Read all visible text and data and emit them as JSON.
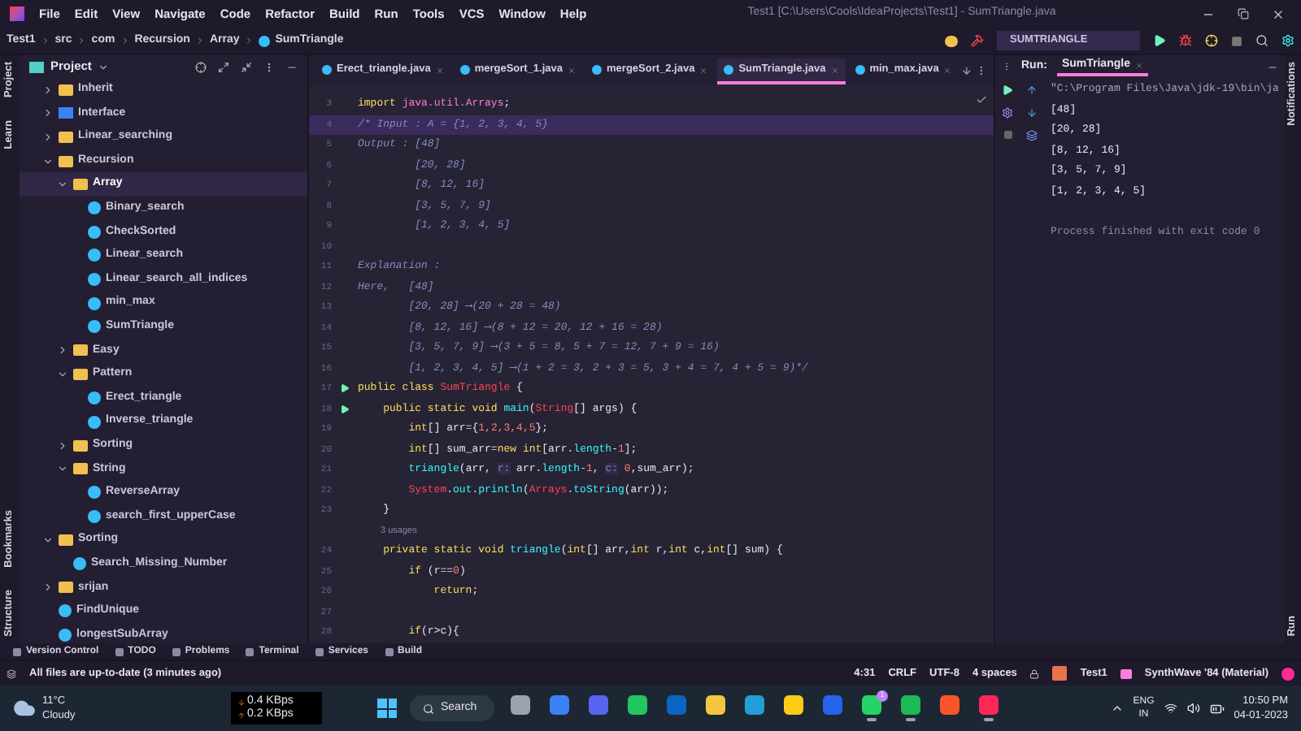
{
  "window": {
    "title": "Test1 [C:\\Users\\Cools\\IdeaProjects\\Test1] - SumTriangle.java"
  },
  "menu": [
    "File",
    "Edit",
    "View",
    "Navigate",
    "Code",
    "Refactor",
    "Build",
    "Run",
    "Tools",
    "VCS",
    "Window",
    "Help"
  ],
  "breadcrumb": [
    "Test1",
    "src",
    "com",
    "Recursion",
    "Array",
    "SumTriangle"
  ],
  "run_config": "SUMTRIANGLE",
  "left_strip": {
    "top": [
      "Project",
      "Learn"
    ],
    "bottom": [
      "Bookmarks",
      "Structure"
    ]
  },
  "project": {
    "title": "Project",
    "tree": [
      {
        "label": "Inherit",
        "kind": "folder",
        "expanded": false,
        "selected": false
      },
      {
        "label": "Interface",
        "kind": "package",
        "expanded": false,
        "selected": false
      },
      {
        "label": "Linear_searching",
        "kind": "folder",
        "expanded": false,
        "selected": false
      },
      {
        "label": "Recursion",
        "kind": "folder",
        "expanded": true,
        "selected": false,
        "children": [
          {
            "label": "Array",
            "kind": "folder",
            "expanded": true,
            "selected": true,
            "children": [
              {
                "label": "Binary_search",
                "kind": "class",
                "selected": false
              },
              {
                "label": "CheckSorted",
                "kind": "class",
                "selected": false
              },
              {
                "label": "Linear_search",
                "kind": "class",
                "selected": false
              },
              {
                "label": "Linear_search_all_indices",
                "kind": "class",
                "selected": false
              },
              {
                "label": "min_max",
                "kind": "class",
                "selected": false
              },
              {
                "label": "SumTriangle",
                "kind": "class",
                "selected": false
              }
            ]
          },
          {
            "label": "Easy",
            "kind": "folder",
            "expanded": false,
            "selected": false
          },
          {
            "label": "Pattern",
            "kind": "folder",
            "expanded": true,
            "selected": false,
            "children": [
              {
                "label": "Erect_triangle",
                "kind": "class",
                "selected": false
              },
              {
                "label": "Inverse_triangle",
                "kind": "class",
                "selected": false
              }
            ]
          },
          {
            "label": "Sorting",
            "kind": "folder",
            "expanded": false,
            "selected": false
          },
          {
            "label": "String",
            "kind": "folder",
            "expanded": true,
            "selected": false,
            "children": [
              {
                "label": "ReverseArray",
                "kind": "class",
                "selected": false
              },
              {
                "label": "search_first_upperCase",
                "kind": "class",
                "selected": false
              }
            ]
          }
        ]
      },
      {
        "label": "Sorting",
        "kind": "folder",
        "expanded": true,
        "selected": false,
        "children": [
          {
            "label": "Search_Missing_Number",
            "kind": "class",
            "selected": false
          }
        ]
      },
      {
        "label": "srijan",
        "kind": "folder",
        "expanded": false,
        "selected": false
      },
      {
        "label": "FindUnique",
        "kind": "class",
        "selected": false
      },
      {
        "label": "longestSubArray",
        "kind": "class",
        "selected": false
      }
    ]
  },
  "editor_tabs": [
    {
      "label": "Erect_triangle.java",
      "selected": false
    },
    {
      "label": "mergeSort_1.java",
      "selected": false
    },
    {
      "label": "mergeSort_2.java",
      "selected": false
    },
    {
      "label": "SumTriangle.java",
      "selected": true
    },
    {
      "label": "min_max.java",
      "selected": false
    }
  ],
  "code_lines": [
    {
      "kind": "code",
      "number": "3",
      "current": false,
      "run_marker": false,
      "tokens": [
        {
          "kind": "kw",
          "text": "import "
        },
        {
          "kind": "pkg",
          "text": "java.util.Arrays"
        },
        {
          "kind": "plain",
          "text": ";"
        }
      ]
    },
    {
      "kind": "code",
      "number": "4",
      "current": true,
      "run_marker": false,
      "tokens": [
        {
          "kind": "cmt",
          "text": "/* Input : A = {1, 2, 3, 4, 5}"
        }
      ]
    },
    {
      "kind": "code",
      "number": "5",
      "current": false,
      "run_marker": false,
      "tokens": [
        {
          "kind": "cmt",
          "text": "Output : [48]"
        }
      ]
    },
    {
      "kind": "code",
      "number": "6",
      "current": false,
      "run_marker": false,
      "tokens": [
        {
          "kind": "cmt",
          "text": "         [20, 28]"
        }
      ]
    },
    {
      "kind": "code",
      "number": "7",
      "current": false,
      "run_marker": false,
      "tokens": [
        {
          "kind": "cmt",
          "text": "         [8, 12, 16]"
        }
      ]
    },
    {
      "kind": "code",
      "number": "8",
      "current": false,
      "run_marker": false,
      "tokens": [
        {
          "kind": "cmt",
          "text": "         [3, 5, 7, 9]"
        }
      ]
    },
    {
      "kind": "code",
      "number": "9",
      "current": false,
      "run_marker": false,
      "tokens": [
        {
          "kind": "cmt",
          "text": "         [1, 2, 3, 4, 5]"
        }
      ]
    },
    {
      "kind": "code",
      "number": "10",
      "current": false,
      "run_marker": false
    },
    {
      "kind": "code",
      "number": "11",
      "current": false,
      "run_marker": false,
      "tokens": [
        {
          "kind": "cmt",
          "text": "Explanation :"
        }
      ]
    },
    {
      "kind": "code",
      "number": "12",
      "current": false,
      "run_marker": false,
      "tokens": [
        {
          "kind": "cmt",
          "text": "Here,   [48]"
        }
      ]
    },
    {
      "kind": "code",
      "number": "13",
      "current": false,
      "run_marker": false,
      "tokens": [
        {
          "kind": "cmt",
          "text": "        [20, 28] ⟶(20 + 28 = 48)"
        }
      ]
    },
    {
      "kind": "code",
      "number": "14",
      "current": false,
      "run_marker": false,
      "tokens": [
        {
          "kind": "cmt",
          "text": "        [8, 12, 16] ⟶(8 + 12 = 20, 12 + 16 = 28)"
        }
      ]
    },
    {
      "kind": "code",
      "number": "15",
      "current": false,
      "run_marker": false,
      "tokens": [
        {
          "kind": "cmt",
          "text": "        [3, 5, 7, 9] ⟶(3 + 5 = 8, 5 + 7 = 12, 7 + 9 = 16)"
        }
      ]
    },
    {
      "kind": "code",
      "number": "16",
      "current": false,
      "run_marker": false,
      "tokens": [
        {
          "kind": "cmt",
          "text": "        [1, 2, 3, 4, 5] ⟶(1 + 2 = 3, 2 + 3 = 5, 3 + 4 = 7, 4 + 5 = 9)*/"
        }
      ]
    },
    {
      "kind": "code",
      "number": "17",
      "current": false,
      "run_marker": true,
      "tokens": [
        {
          "kind": "kw",
          "text": "public class "
        },
        {
          "kind": "cls",
          "text": "SumTriangle"
        },
        {
          "kind": "plain",
          "text": " {"
        }
      ]
    },
    {
      "kind": "code",
      "number": "18",
      "current": false,
      "run_marker": true,
      "tokens": [
        {
          "kind": "kw",
          "text": "    public static void "
        },
        {
          "kind": "fn",
          "text": "main"
        },
        {
          "kind": "plain",
          "text": "("
        },
        {
          "kind": "cls",
          "text": "String"
        },
        {
          "kind": "plain",
          "text": "[] args) {"
        }
      ]
    },
    {
      "kind": "code",
      "number": "19",
      "current": false,
      "run_marker": false,
      "tokens": [
        {
          "kind": "type",
          "text": "        int"
        },
        {
          "kind": "plain",
          "text": "[] arr={"
        },
        {
          "kind": "num",
          "text": "1,2,3,4,5"
        },
        {
          "kind": "plain",
          "text": "};"
        }
      ]
    },
    {
      "kind": "code",
      "number": "20",
      "current": false,
      "run_marker": false,
      "tokens": [
        {
          "kind": "type",
          "text": "        int"
        },
        {
          "kind": "plain",
          "text": "[] sum_arr="
        },
        {
          "kind": "kw",
          "text": "new "
        },
        {
          "kind": "type",
          "text": "int"
        },
        {
          "kind": "plain",
          "text": "[arr."
        },
        {
          "kind": "fn",
          "text": "length"
        },
        {
          "kind": "plain",
          "text": "-"
        },
        {
          "kind": "num",
          "text": "1"
        },
        {
          "kind": "plain",
          "text": "];"
        }
      ]
    },
    {
      "kind": "code",
      "number": "21",
      "current": false,
      "run_marker": false,
      "tokens": [
        {
          "kind": "fn",
          "text": "        triangle"
        },
        {
          "kind": "plain",
          "text": "(arr, "
        },
        {
          "kind": "hint",
          "text": "r:"
        },
        {
          "kind": "plain",
          "text": " arr."
        },
        {
          "kind": "fn",
          "text": "length"
        },
        {
          "kind": "plain",
          "text": "-"
        },
        {
          "kind": "num",
          "text": "1"
        },
        {
          "kind": "plain",
          "text": ", "
        },
        {
          "kind": "hint",
          "text": "c:"
        },
        {
          "kind": "num",
          "text": " 0"
        },
        {
          "kind": "plain",
          "text": ",sum_arr);"
        }
      ]
    },
    {
      "kind": "code",
      "number": "22",
      "current": false,
      "run_marker": false,
      "tokens": [
        {
          "kind": "cls",
          "text": "        System"
        },
        {
          "kind": "plain",
          "text": "."
        },
        {
          "kind": "fn",
          "text": "out"
        },
        {
          "kind": "plain",
          "text": "."
        },
        {
          "kind": "fn",
          "text": "println"
        },
        {
          "kind": "plain",
          "text": "("
        },
        {
          "kind": "cls",
          "text": "Arrays"
        },
        {
          "kind": "plain",
          "text": "."
        },
        {
          "kind": "fn",
          "text": "toString"
        },
        {
          "kind": "plain",
          "text": "(arr));"
        }
      ]
    },
    {
      "kind": "code",
      "number": "23",
      "current": false,
      "run_marker": false,
      "tokens": [
        {
          "kind": "plain",
          "text": "    }"
        }
      ]
    },
    {
      "kind": "usages",
      "text": "3 usages"
    },
    {
      "kind": "code",
      "number": "24",
      "current": false,
      "run_marker": false,
      "tokens": [
        {
          "kind": "kw",
          "text": "    private static void "
        },
        {
          "kind": "fn",
          "text": "triangle"
        },
        {
          "kind": "plain",
          "text": "("
        },
        {
          "kind": "type",
          "text": "int"
        },
        {
          "kind": "plain",
          "text": "[] arr,"
        },
        {
          "kind": "type",
          "text": "int"
        },
        {
          "kind": "plain",
          "text": " r,"
        },
        {
          "kind": "type",
          "text": "int"
        },
        {
          "kind": "plain",
          "text": " c,"
        },
        {
          "kind": "type",
          "text": "int"
        },
        {
          "kind": "plain",
          "text": "[] sum) {"
        }
      ]
    },
    {
      "kind": "code",
      "number": "25",
      "current": false,
      "run_marker": false,
      "tokens": [
        {
          "kind": "kw",
          "text": "        if "
        },
        {
          "kind": "plain",
          "text": "(r=="
        },
        {
          "kind": "num",
          "text": "0"
        },
        {
          "kind": "plain",
          "text": ")"
        }
      ]
    },
    {
      "kind": "code",
      "number": "26",
      "current": false,
      "run_marker": false,
      "tokens": [
        {
          "kind": "kw",
          "text": "            return"
        },
        {
          "kind": "plain",
          "text": ";"
        }
      ]
    },
    {
      "kind": "code",
      "number": "27",
      "current": false,
      "run_marker": false
    },
    {
      "kind": "code",
      "number": "28",
      "current": false,
      "run_marker": false,
      "tokens": [
        {
          "kind": "kw",
          "text": "        if"
        },
        {
          "kind": "plain",
          "text": "(r>c){"
        }
      ]
    }
  ],
  "run_panel": {
    "label": "Run:",
    "tab": "SumTriangle",
    "output": [
      {
        "kind": "command",
        "text": "\"C:\\Program Files\\Java\\jdk-19\\bin\\ja"
      },
      {
        "kind": "out",
        "text": "[48]"
      },
      {
        "kind": "out",
        "text": "[20, 28]"
      },
      {
        "kind": "out",
        "text": "[8, 12, 16]"
      },
      {
        "kind": "out",
        "text": "[3, 5, 7, 9]"
      },
      {
        "kind": "out",
        "text": "[1, 2, 3, 4, 5]"
      },
      {
        "kind": "gap"
      },
      {
        "kind": "system",
        "text": "Process finished with exit code 0"
      }
    ]
  },
  "right_strip": {
    "top": "Notifications",
    "bottom": "Run"
  },
  "tool_windows": [
    "Version Control",
    "TODO",
    "Problems",
    "Terminal",
    "Services",
    "Build"
  ],
  "status_bar": {
    "message": "All files are up-to-date (3 minutes ago)",
    "items": [
      "4:31",
      "CRLF",
      "UTF-8",
      "4 spaces"
    ],
    "project": "Test1",
    "theme": "SynthWave '84 (Material)"
  },
  "taskbar": {
    "weather": {
      "temp": "11°C",
      "condition": "Cloudy"
    },
    "network": {
      "down": "0.4 KBps",
      "up": "0.2 KBps"
    },
    "search": "Search",
    "apps": [
      {
        "color": "#9ca3af",
        "running": false
      },
      {
        "color": "#3b82f6",
        "running": false
      },
      {
        "color": "#5865f2",
        "running": false
      },
      {
        "color": "#22c55e",
        "running": false
      },
      {
        "color": "#0a66c2",
        "running": false
      },
      {
        "color": "#f5c542",
        "running": false
      },
      {
        "color": "#229ed9",
        "running": false
      },
      {
        "color": "#facc15",
        "running": false
      },
      {
        "color": "#2563eb",
        "running": false
      },
      {
        "color": "#25d366",
        "running": true
      },
      {
        "color": "#1db954",
        "running": true
      },
      {
        "color": "#fb542b",
        "running": false
      },
      {
        "color": "#fe2857",
        "running": true
      }
    ],
    "badge": "1",
    "lang": "ENG",
    "region": "IN",
    "time": "10:50 PM",
    "date": "04-01-2023"
  }
}
